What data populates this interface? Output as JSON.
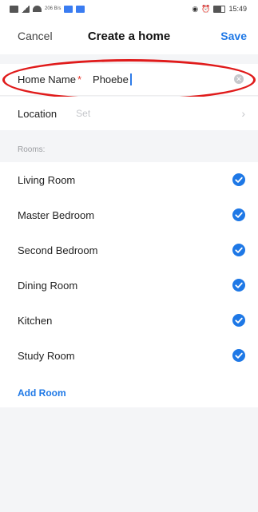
{
  "status_bar": {
    "network_small": "206\nB/s",
    "time": "15:49"
  },
  "header": {
    "cancel_label": "Cancel",
    "title": "Create a home",
    "save_label": "Save"
  },
  "home_name": {
    "label": "Home Name",
    "required_mark": "*",
    "value": "Phoebe"
  },
  "location": {
    "label": "Location",
    "placeholder": "Set"
  },
  "rooms": {
    "section_label": "Rooms:",
    "items": [
      {
        "label": "Living Room",
        "checked": true
      },
      {
        "label": "Master Bedroom",
        "checked": true
      },
      {
        "label": "Second Bedroom",
        "checked": true
      },
      {
        "label": "Dining Room",
        "checked": true
      },
      {
        "label": "Kitchen",
        "checked": true
      },
      {
        "label": "Study Room",
        "checked": true
      }
    ],
    "add_label": "Add Room"
  },
  "colors": {
    "accent": "#1e78e6",
    "required": "#e8352b",
    "highlight": "#e01b1b"
  }
}
